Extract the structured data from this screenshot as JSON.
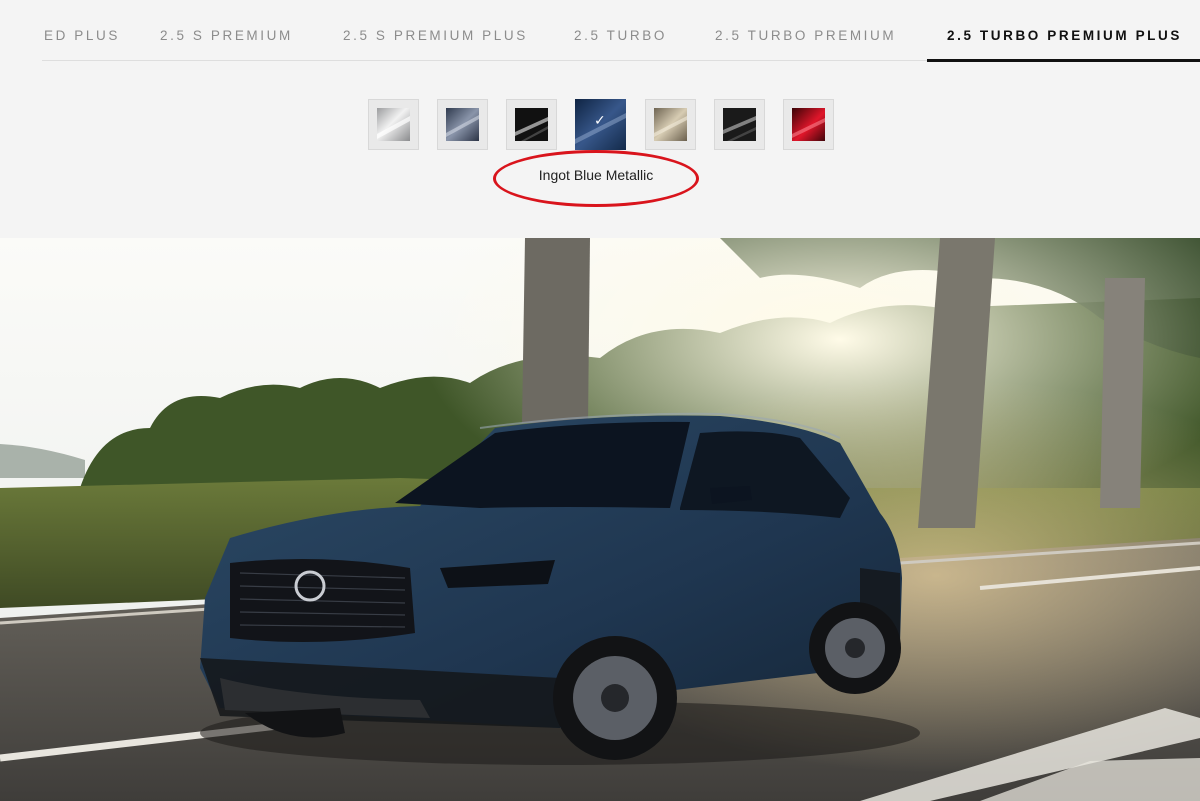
{
  "trim_tabs": [
    {
      "label": "ED PLUS",
      "active": false
    },
    {
      "label": "2.5 S PREMIUM",
      "active": false
    },
    {
      "label": "2.5 S PREMIUM PLUS",
      "active": false
    },
    {
      "label": "2.5 TURBO",
      "active": false
    },
    {
      "label": "2.5 TURBO PREMIUM",
      "active": false
    },
    {
      "label": "2.5 TURBO PREMIUM PLUS",
      "active": true
    }
  ],
  "colors": {
    "selected_index": 3,
    "selected_name": "Ingot Blue Metallic",
    "checkmark": "✓",
    "swatches": [
      {
        "hex": "#c9cacc",
        "icon": "silver-swatch"
      },
      {
        "hex": "#5a6478",
        "icon": "gray-blue-swatch"
      },
      {
        "hex": "#1e1e1e",
        "icon": "black-swatch"
      },
      {
        "hex": "#1f3a5c",
        "icon": "blue-swatch"
      },
      {
        "hex": "#a99c84",
        "icon": "beige-swatch"
      },
      {
        "hex": "#2a2a2a",
        "icon": "dark-swatch"
      },
      {
        "hex": "#9e0d16",
        "icon": "red-swatch"
      }
    ]
  },
  "accent_colors": {
    "active_tab_underline": "#111111",
    "annotation_ring": "#d9141c"
  }
}
